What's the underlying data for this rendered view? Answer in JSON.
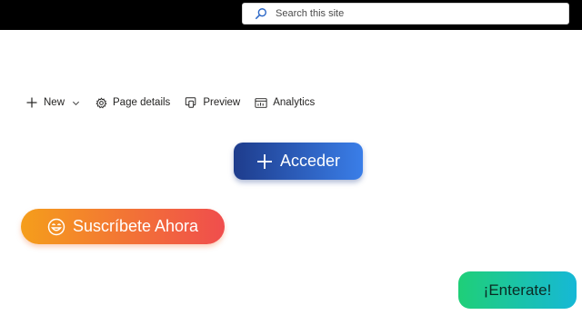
{
  "header": {
    "search": {
      "placeholder": "Search this site"
    }
  },
  "command_bar": {
    "items": [
      {
        "label": "New",
        "icon": "plus-icon",
        "has_dropdown": true
      },
      {
        "label": "Page details",
        "icon": "gear-icon"
      },
      {
        "label": "Preview",
        "icon": "preview-icon"
      },
      {
        "label": "Analytics",
        "icon": "analytics-icon"
      }
    ]
  },
  "buttons": {
    "acceder": {
      "label": "Acceder",
      "icon": "plus-icon",
      "colors": [
        "#1e3c8c",
        "#3a7ee8"
      ]
    },
    "suscribete": {
      "label": "Suscríbete Ahora",
      "icon": "smile-icon",
      "colors": [
        "#f59e1b",
        "#f04d4d"
      ]
    },
    "enterate": {
      "label": "¡Enterate!",
      "colors": [
        "#1fcf78",
        "#16b8d6"
      ]
    }
  },
  "colors": {
    "topbar": "#000000",
    "background": "#ffffff",
    "command_text": "#252423"
  }
}
